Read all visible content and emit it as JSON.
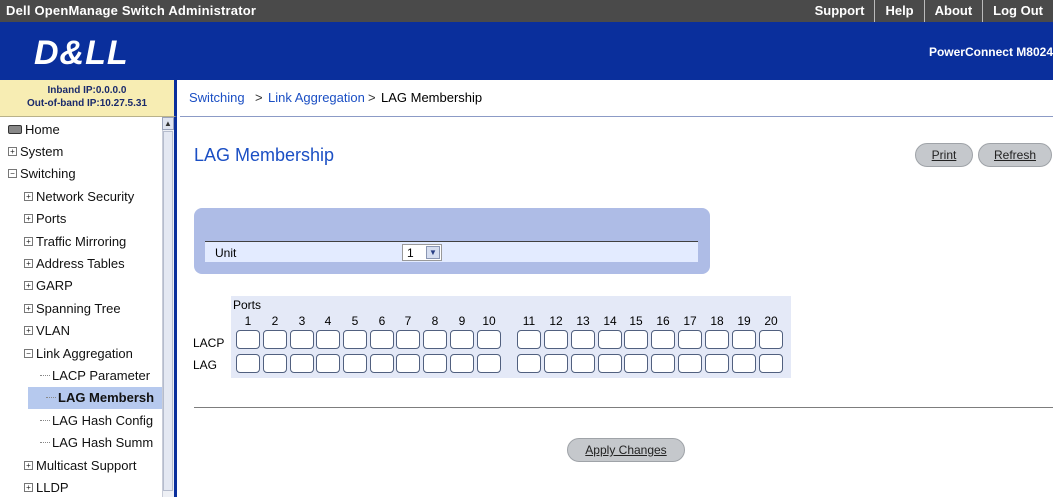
{
  "header": {
    "app_title": "Dell OpenManage Switch Administrator",
    "links": [
      "Support",
      "Help",
      "About",
      "Log Out"
    ],
    "logo_text": "D&LL",
    "model": "PowerConnect M8024"
  },
  "ip_info": {
    "inband": "Inband IP:0.0.0.0",
    "outofband": "Out-of-band IP:10.27.5.31"
  },
  "breadcrumb": {
    "items": [
      "Switching",
      "Link Aggregation",
      "LAG Membership"
    ],
    "separator": ">"
  },
  "nav_tree": [
    {
      "label": "Home",
      "level": 0,
      "icon": "home"
    },
    {
      "label": "System",
      "level": 0,
      "icon": "expand"
    },
    {
      "label": "Switching",
      "level": 0,
      "icon": "collapse"
    },
    {
      "label": "Network Security",
      "level": 1,
      "icon": "expand"
    },
    {
      "label": "Ports",
      "level": 1,
      "icon": "expand"
    },
    {
      "label": "Traffic Mirroring",
      "level": 1,
      "icon": "expand"
    },
    {
      "label": "Address Tables",
      "level": 1,
      "icon": "expand"
    },
    {
      "label": "GARP",
      "level": 1,
      "icon": "expand"
    },
    {
      "label": "Spanning Tree",
      "level": 1,
      "icon": "expand"
    },
    {
      "label": "VLAN",
      "level": 1,
      "icon": "expand"
    },
    {
      "label": "Link Aggregation",
      "level": 1,
      "icon": "collapse"
    },
    {
      "label": "LACP Parameter",
      "level": 2,
      "icon": "leaf"
    },
    {
      "label": "LAG Membersh",
      "level": 2,
      "icon": "leaf",
      "selected": true
    },
    {
      "label": "LAG Hash Config",
      "level": 2,
      "icon": "leaf"
    },
    {
      "label": "LAG Hash Summ",
      "level": 2,
      "icon": "leaf"
    },
    {
      "label": "Multicast Support",
      "level": 1,
      "icon": "expand"
    },
    {
      "label": "LLDP",
      "level": 1,
      "icon": "expand"
    }
  ],
  "main": {
    "title": "LAG Membership",
    "print_label": "Print",
    "refresh_label": "Refresh",
    "unit_label": "Unit",
    "unit_value": "1",
    "ports_label": "Ports",
    "port_numbers": [
      "1",
      "2",
      "3",
      "4",
      "5",
      "6",
      "7",
      "8",
      "9",
      "10",
      "11",
      "12",
      "13",
      "14",
      "15",
      "16",
      "17",
      "18",
      "19",
      "20"
    ],
    "row_labels": [
      "LACP",
      "LAG"
    ],
    "apply_label": "Apply Changes"
  },
  "colors": {
    "banner": "#0a2f9c",
    "link": "#1b4fc4",
    "panel": "#aebce6"
  }
}
